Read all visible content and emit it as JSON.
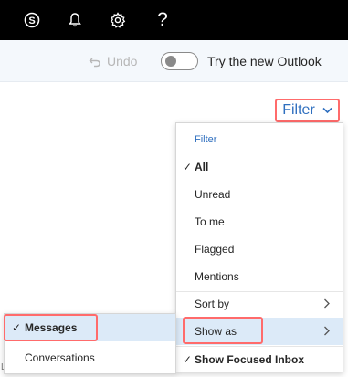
{
  "topbar": {
    "icons": [
      "skype-icon",
      "bell-icon",
      "gear-icon",
      "help-icon"
    ],
    "help_glyph": "?"
  },
  "toolbar": {
    "undo_label": "Undo",
    "toggle_state": "off",
    "try_label": "Try the new Outlook"
  },
  "filter_button": {
    "label": "Filter"
  },
  "filter_menu": {
    "header": "Filter",
    "items": [
      {
        "label": "All",
        "checked": true
      },
      {
        "label": "Unread",
        "checked": false
      },
      {
        "label": "To me",
        "checked": false
      },
      {
        "label": "Flagged",
        "checked": false
      },
      {
        "label": "Mentions",
        "checked": false
      }
    ],
    "sort_by": "Sort by",
    "show_as": "Show as",
    "show_focused": "Show Focused Inbox",
    "show_focused_checked": true
  },
  "show_as_submenu": {
    "items": [
      {
        "label": "Messages",
        "checked": true
      },
      {
        "label": "Conversations",
        "checked": false
      }
    ]
  },
  "colors": {
    "accent": "#2f6fbf",
    "highlight": "#dceaf8",
    "annotation": "#ff6b6b"
  },
  "fragments": {
    "left_char": "L"
  }
}
